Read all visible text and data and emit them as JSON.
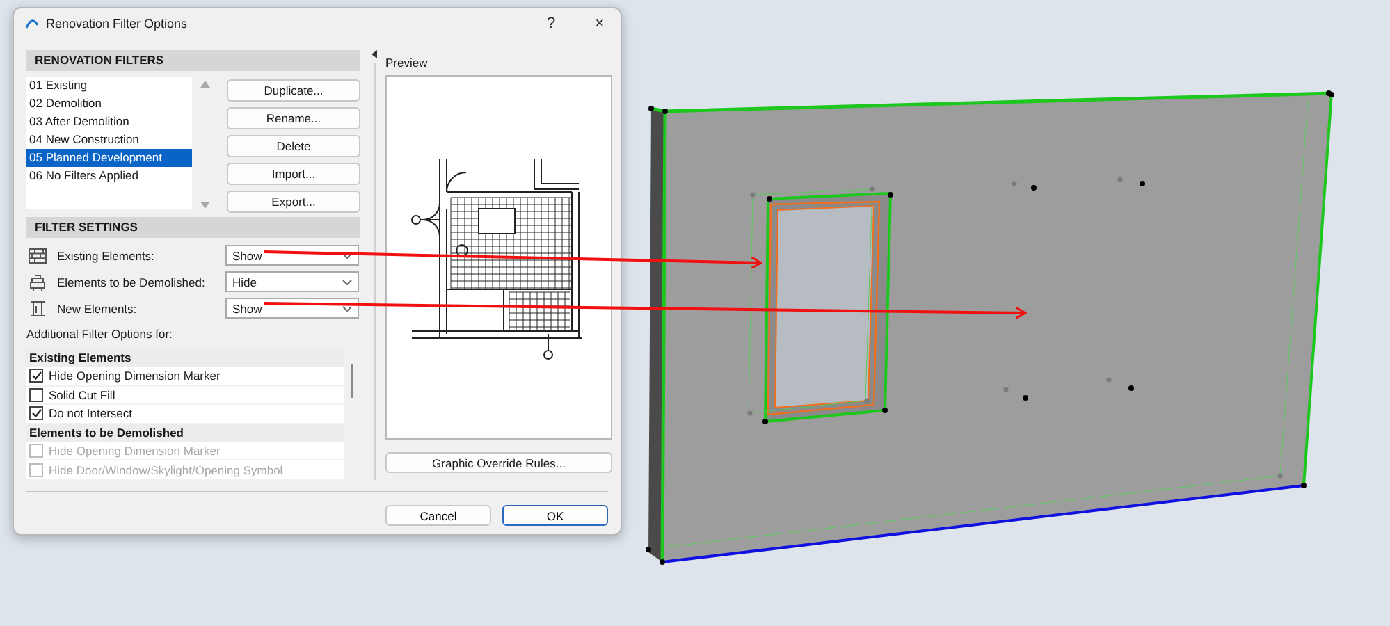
{
  "window": {
    "title": "Renovation Filter Options",
    "help_button": "?",
    "close_button": "×"
  },
  "renovation_filters": {
    "heading": "RENOVATION FILTERS",
    "items": [
      {
        "label": "01 Existing",
        "selected": false
      },
      {
        "label": "02 Demolition",
        "selected": false
      },
      {
        "label": "03 After Demolition",
        "selected": false
      },
      {
        "label": "04 New Construction",
        "selected": false
      },
      {
        "label": "05 Planned Development",
        "selected": true
      },
      {
        "label": "06 No Filters Applied",
        "selected": false
      }
    ],
    "buttons": [
      "Duplicate...",
      "Rename...",
      "Delete",
      "Import...",
      "Export..."
    ]
  },
  "filter_settings": {
    "heading": "FILTER SETTINGS",
    "rows": [
      {
        "label": "Existing Elements:",
        "value": "Show"
      },
      {
        "label": "Elements to be Demolished:",
        "value": "Hide"
      },
      {
        "label": "New Elements:",
        "value": "Show"
      }
    ]
  },
  "additional_label": "Additional Filter Options for:",
  "options": [
    {
      "kind": "group",
      "label": "Existing Elements"
    },
    {
      "kind": "checkbox",
      "label": "Hide Opening Dimension Marker",
      "checked": true,
      "disabled": false
    },
    {
      "kind": "checkbox",
      "label": "Solid Cut Fill",
      "checked": false,
      "disabled": false
    },
    {
      "kind": "checkbox",
      "label": "Do not Intersect",
      "checked": true,
      "disabled": false
    },
    {
      "kind": "group",
      "label": "Elements to be Demolished"
    },
    {
      "kind": "checkbox",
      "label": "Hide Opening Dimension Marker",
      "checked": false,
      "disabled": true
    },
    {
      "kind": "checkbox",
      "label": "Hide Door/Window/Skylight/Opening Symbol",
      "checked": false,
      "disabled": true
    }
  ],
  "preview": {
    "label": "Preview",
    "button": "Graphic Override Rules..."
  },
  "footer_buttons": [
    {
      "label": "Cancel",
      "default": false
    },
    {
      "label": "OK",
      "default": true
    }
  ]
}
